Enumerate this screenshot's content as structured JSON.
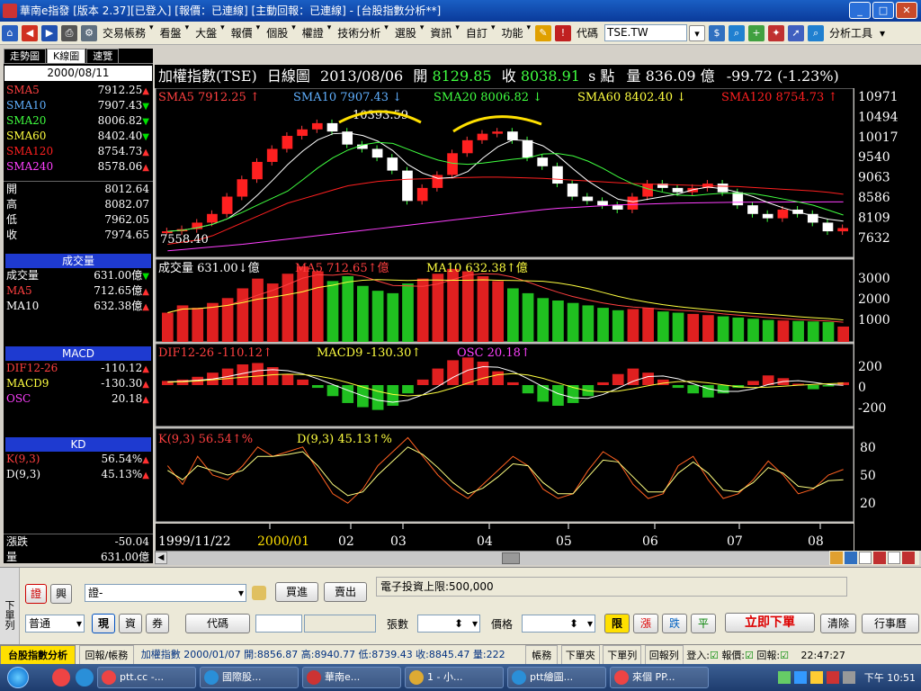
{
  "window": {
    "title": "華南e指發 [版本 2.37][已登入] [報價：已連線] [主動回報：已連線] - [台股指數分析**]"
  },
  "menu": {
    "items": [
      "交易帳務",
      "看盤",
      "大盤",
      "報價",
      "個股",
      "權證",
      "技術分析",
      "選股",
      "資訊",
      "自訂",
      "功能"
    ],
    "code_label": "代碼",
    "code_value": "TSE.TW",
    "tools_label": "分析工具"
  },
  "left_panel": {
    "tabs": [
      "走勢圖",
      "K線圖",
      "速覽"
    ],
    "date": "2000/08/11",
    "ma": [
      {
        "name": "SMA5",
        "value": "7912.25",
        "dir": "up",
        "color": "#ff4040"
      },
      {
        "name": "SMA10",
        "value": "7907.43",
        "dir": "down",
        "color": "#60b0ff"
      },
      {
        "name": "SMA20",
        "value": "8006.82",
        "dir": "down",
        "color": "#40ff40"
      },
      {
        "name": "SMA60",
        "value": "8402.40",
        "dir": "down",
        "color": "#ffff40"
      },
      {
        "name": "SMA120",
        "value": "8754.73",
        "dir": "up",
        "color": "#ff2020"
      },
      {
        "name": "SMA240",
        "value": "8578.06",
        "dir": "up",
        "color": "#ff40ff"
      }
    ],
    "ohlc": [
      {
        "name": "開",
        "value": "8012.64"
      },
      {
        "name": "高",
        "value": "8082.07"
      },
      {
        "name": "低",
        "value": "7962.05"
      },
      {
        "name": "收",
        "value": "7974.65"
      }
    ],
    "volume_section": {
      "title": "成交量",
      "rows": [
        {
          "name": "成交量",
          "value": "631.00億",
          "dir": "down",
          "color": "#ffffff"
        },
        {
          "name": "MA5",
          "value": "712.65億",
          "dir": "up",
          "color": "#ff4040"
        },
        {
          "name": "MA10",
          "value": "632.38億",
          "dir": "up",
          "color": "#ffffff"
        }
      ]
    },
    "macd_section": {
      "title": "MACD",
      "rows": [
        {
          "name": "DIF12-26",
          "value": "-110.12",
          "dir": "up",
          "color": "#ff4040"
        },
        {
          "name": "MACD9",
          "value": "-130.30",
          "dir": "up",
          "color": "#ffff40"
        },
        {
          "name": "OSC",
          "value": "20.18",
          "dir": "up",
          "color": "#ff40ff"
        }
      ]
    },
    "kd_section": {
      "title": "KD",
      "rows": [
        {
          "name": "K(9,3)",
          "value": "56.54%",
          "dir": "up",
          "color": "#ff4040"
        },
        {
          "name": "D(9,3)",
          "value": "45.13%",
          "dir": "up",
          "color": "#ffffff"
        }
      ]
    },
    "change": {
      "name": "漲跌",
      "value": "-50.04"
    },
    "volume": {
      "name": "量",
      "value": "631.00億"
    }
  },
  "chart_header": {
    "name": "加權指數(TSE)",
    "period": "日線圖",
    "date": "2013/08/06",
    "open_label": "開",
    "open": "8129.85",
    "close_label": "收",
    "close": "8038.91",
    "unit": "s 點",
    "vol_label": "量",
    "vol": "836.09 億",
    "change": "-99.72 (-1.23%)"
  },
  "price_legend": [
    {
      "text": "SMA5 7912.25",
      "dir": "up",
      "color": "#ff4040"
    },
    {
      "text": "SMA10 7907.43",
      "dir": "down",
      "color": "#60b0ff"
    },
    {
      "text": "SMA20 8006.82",
      "dir": "down",
      "color": "#40ff40"
    },
    {
      "text": "SMA60 8402.40",
      "dir": "down",
      "color": "#ffff40"
    },
    {
      "text": "SMA120 8754.73",
      "dir": "up",
      "color": "#ff2020"
    }
  ],
  "vol_legend": [
    {
      "text": "成交量 631.00",
      "dir": "down",
      "suffix": "億",
      "color": "#ffffff"
    },
    {
      "text": "MA5 712.65",
      "dir": "up",
      "suffix": "億",
      "color": "#ff4040"
    },
    {
      "text": "MA10 632.38",
      "dir": "up",
      "suffix": "億",
      "color": "#ffff40"
    }
  ],
  "macd_legend": [
    {
      "text": "DIF12-26 -110.12",
      "dir": "up",
      "color": "#ff4040"
    },
    {
      "text": "MACD9 -130.30",
      "dir": "up",
      "color": "#ffff40"
    },
    {
      "text": "OSC 20.18",
      "dir": "up",
      "color": "#ff40ff"
    }
  ],
  "kd_legend": [
    {
      "text": "K(9,3) 56.54",
      "dir": "up",
      "suffix": "%",
      "color": "#ff4040"
    },
    {
      "text": "D(9,3) 45.13",
      "dir": "up",
      "suffix": "%",
      "color": "#ffff40"
    }
  ],
  "chart_data": {
    "type": "line",
    "price_axis": [
      "10971",
      "10494",
      "10017",
      "9540",
      "9063",
      "8586",
      "8109",
      "7632"
    ],
    "volume_axis": [
      "3000",
      "2000",
      "1000"
    ],
    "macd_axis": [
      "200",
      "0",
      "-200"
    ],
    "kd_axis": [
      "80",
      "50",
      "20"
    ],
    "x_labels": [
      "1999/11/22",
      "2000/01",
      "02",
      "03",
      "04",
      "05",
      "06",
      "07",
      "08"
    ],
    "annotations": {
      "high": "10393.59",
      "low": "7558.40"
    },
    "price_close": [
      7900,
      7950,
      8100,
      8300,
      8700,
      9100,
      9500,
      9800,
      10100,
      10250,
      10393,
      10200,
      9900,
      9800,
      9600,
      9300,
      8600,
      8900,
      9200,
      9700,
      10000,
      10150,
      10200,
      10000,
      9600,
      9400,
      9000,
      8700,
      8600,
      8500,
      8400,
      8700,
      9000,
      8900,
      8800,
      8900,
      9000,
      8800,
      8500,
      8300,
      8200,
      8400,
      8300,
      8100,
      7900,
      7974
    ],
    "sma_long": [
      7600,
      7650,
      7700,
      7800,
      7950,
      8100,
      8250,
      8400,
      8550,
      8650,
      8750,
      8850,
      8950,
      9000,
      9050,
      9080,
      9100,
      9110,
      9120,
      9130,
      9140,
      9150,
      9150,
      9140,
      9130,
      9120,
      9100,
      9080,
      9060,
      9040,
      9020,
      9000,
      8990,
      8980,
      8970,
      8960,
      8950,
      8940,
      8930,
      8910,
      8890,
      8870,
      8850,
      8830,
      8800,
      8755
    ],
    "sma_240": [
      7450,
      7480,
      7510,
      7540,
      7570,
      7600,
      7640,
      7680,
      7720,
      7760,
      7800,
      7840,
      7880,
      7920,
      7960,
      8000,
      8040,
      8080,
      8120,
      8160,
      8200,
      8240,
      8280,
      8320,
      8360,
      8400,
      8430,
      8450,
      8470,
      8490,
      8510,
      8520,
      8530,
      8540,
      8550,
      8555,
      8560,
      8565,
      8570,
      8572,
      8574,
      8575,
      8576,
      8577,
      8578,
      8578
    ],
    "volume": [
      1200,
      1500,
      1400,
      1600,
      1800,
      2200,
      2600,
      2400,
      2800,
      3100,
      2900,
      2500,
      2700,
      2300,
      2100,
      2000,
      2400,
      2600,
      2800,
      3000,
      2900,
      2700,
      2500,
      2200,
      2000,
      1800,
      1700,
      1600,
      1500,
      1400,
      1300,
      1350,
      1400,
      1250,
      1200,
      1150,
      1100,
      1050,
      1000,
      950,
      900,
      880,
      860,
      840,
      820,
      631
    ],
    "macd_osc": [
      30,
      40,
      60,
      90,
      120,
      150,
      160,
      130,
      80,
      40,
      -20,
      -80,
      -130,
      -160,
      -180,
      -150,
      -60,
      40,
      120,
      180,
      200,
      170,
      100,
      20,
      -60,
      -120,
      -150,
      -130,
      -80,
      20,
      80,
      120,
      90,
      40,
      -20,
      -60,
      -90,
      -60,
      -20,
      30,
      70,
      50,
      10,
      -30,
      -10,
      20
    ],
    "kd_k": [
      60,
      40,
      70,
      50,
      45,
      60,
      80,
      70,
      75,
      80,
      55,
      30,
      20,
      35,
      60,
      75,
      90,
      70,
      50,
      35,
      25,
      40,
      55,
      70,
      60,
      35,
      25,
      30,
      55,
      75,
      65,
      40,
      25,
      30,
      60,
      70,
      45,
      25,
      30,
      45,
      65,
      50,
      30,
      35,
      50,
      56
    ],
    "kd_d": [
      55,
      45,
      60,
      55,
      50,
      55,
      70,
      70,
      72,
      75,
      60,
      40,
      28,
      32,
      50,
      65,
      80,
      72,
      58,
      42,
      30,
      36,
      48,
      62,
      60,
      42,
      30,
      30,
      48,
      66,
      64,
      48,
      32,
      32,
      52,
      64,
      52,
      34,
      32,
      42,
      58,
      52,
      38,
      36,
      44,
      45
    ]
  },
  "order_panel": {
    "side_label": "下單列",
    "securities_label": "證",
    "futures_label": "興",
    "account_value": "證-",
    "buy_label": "買進",
    "sell_label": "賣出",
    "investment_limit": "電子投資上限:500,000",
    "type_value": "普通",
    "cash_label": "現",
    "margin_label": "資",
    "short_label": "券",
    "code_label": "代碼",
    "qty_label": "張數",
    "price_label": "價格",
    "limit_label": "限",
    "up_label": "漲",
    "down_label": "跌",
    "flat_label": "平",
    "order_now_label": "立即下單",
    "clear_label": "清除",
    "calendar_label": "行事曆"
  },
  "status_bar": {
    "tab_active": "台股指數分析",
    "tab_report": "回報/帳務",
    "quote": "加權指數 2000/01/07 開:8856.87 高:8940.77 低:8739.43 收:8845.47 量:222",
    "btn_account": "帳務",
    "btn_order": "下單夾",
    "btn_order_list": "下單列",
    "btn_report_list": "回報列",
    "login_label": "登入:",
    "quote_label": "報價:",
    "report_label": "回報:",
    "time": "22:47:27"
  },
  "taskbar": {
    "tasks": [
      "ptt.cc -...",
      "國際股...",
      "華南e...",
      "1 - 小...",
      "ptt繪圖...",
      "來個 PP..."
    ],
    "clock": "下午 10:51"
  }
}
